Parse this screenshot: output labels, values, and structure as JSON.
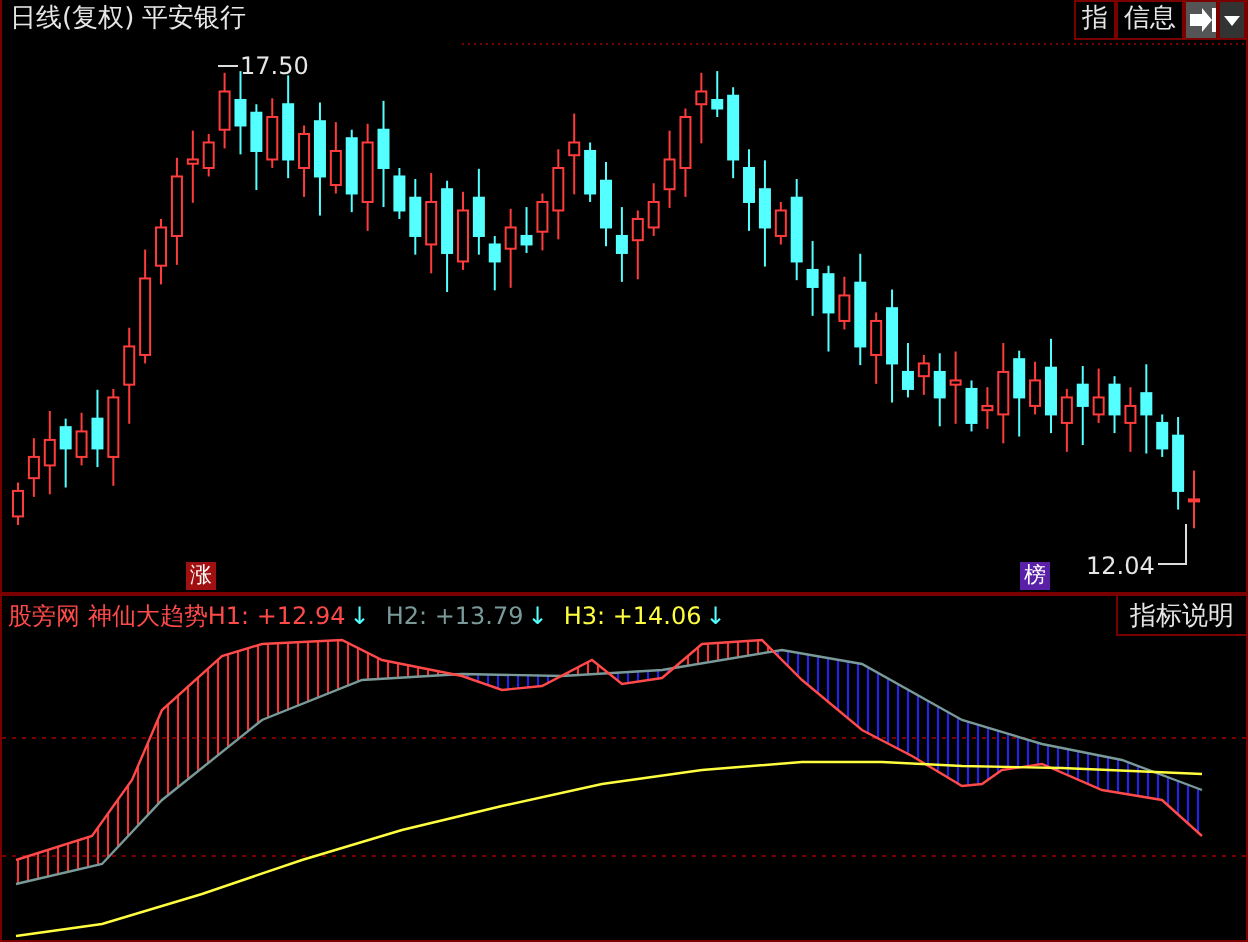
{
  "header": {
    "period": "日线(复权)",
    "stock": "平安银行"
  },
  "toolbar": [
    {
      "label": "指"
    },
    {
      "label": "信息"
    }
  ],
  "price_chart": {
    "high_label": "17.50",
    "low_label": "12.04",
    "badges": [
      {
        "label": "涨",
        "color": "#a01010"
      },
      {
        "label": "榜",
        "color": "#5a20a8"
      }
    ]
  },
  "indicator": {
    "name": "股旁网 神仙大趋势",
    "lines": [
      {
        "label": "H1: +12.94",
        "color": "#ff4a4a",
        "arrow": "↓"
      },
      {
        "label": "H2: +13.79",
        "color": "#7a9a9a",
        "arrow": "↓"
      },
      {
        "label": "H3: +14.06",
        "color": "#ffff40",
        "arrow": "↓"
      }
    ],
    "help_button": "指标说明"
  }
}
